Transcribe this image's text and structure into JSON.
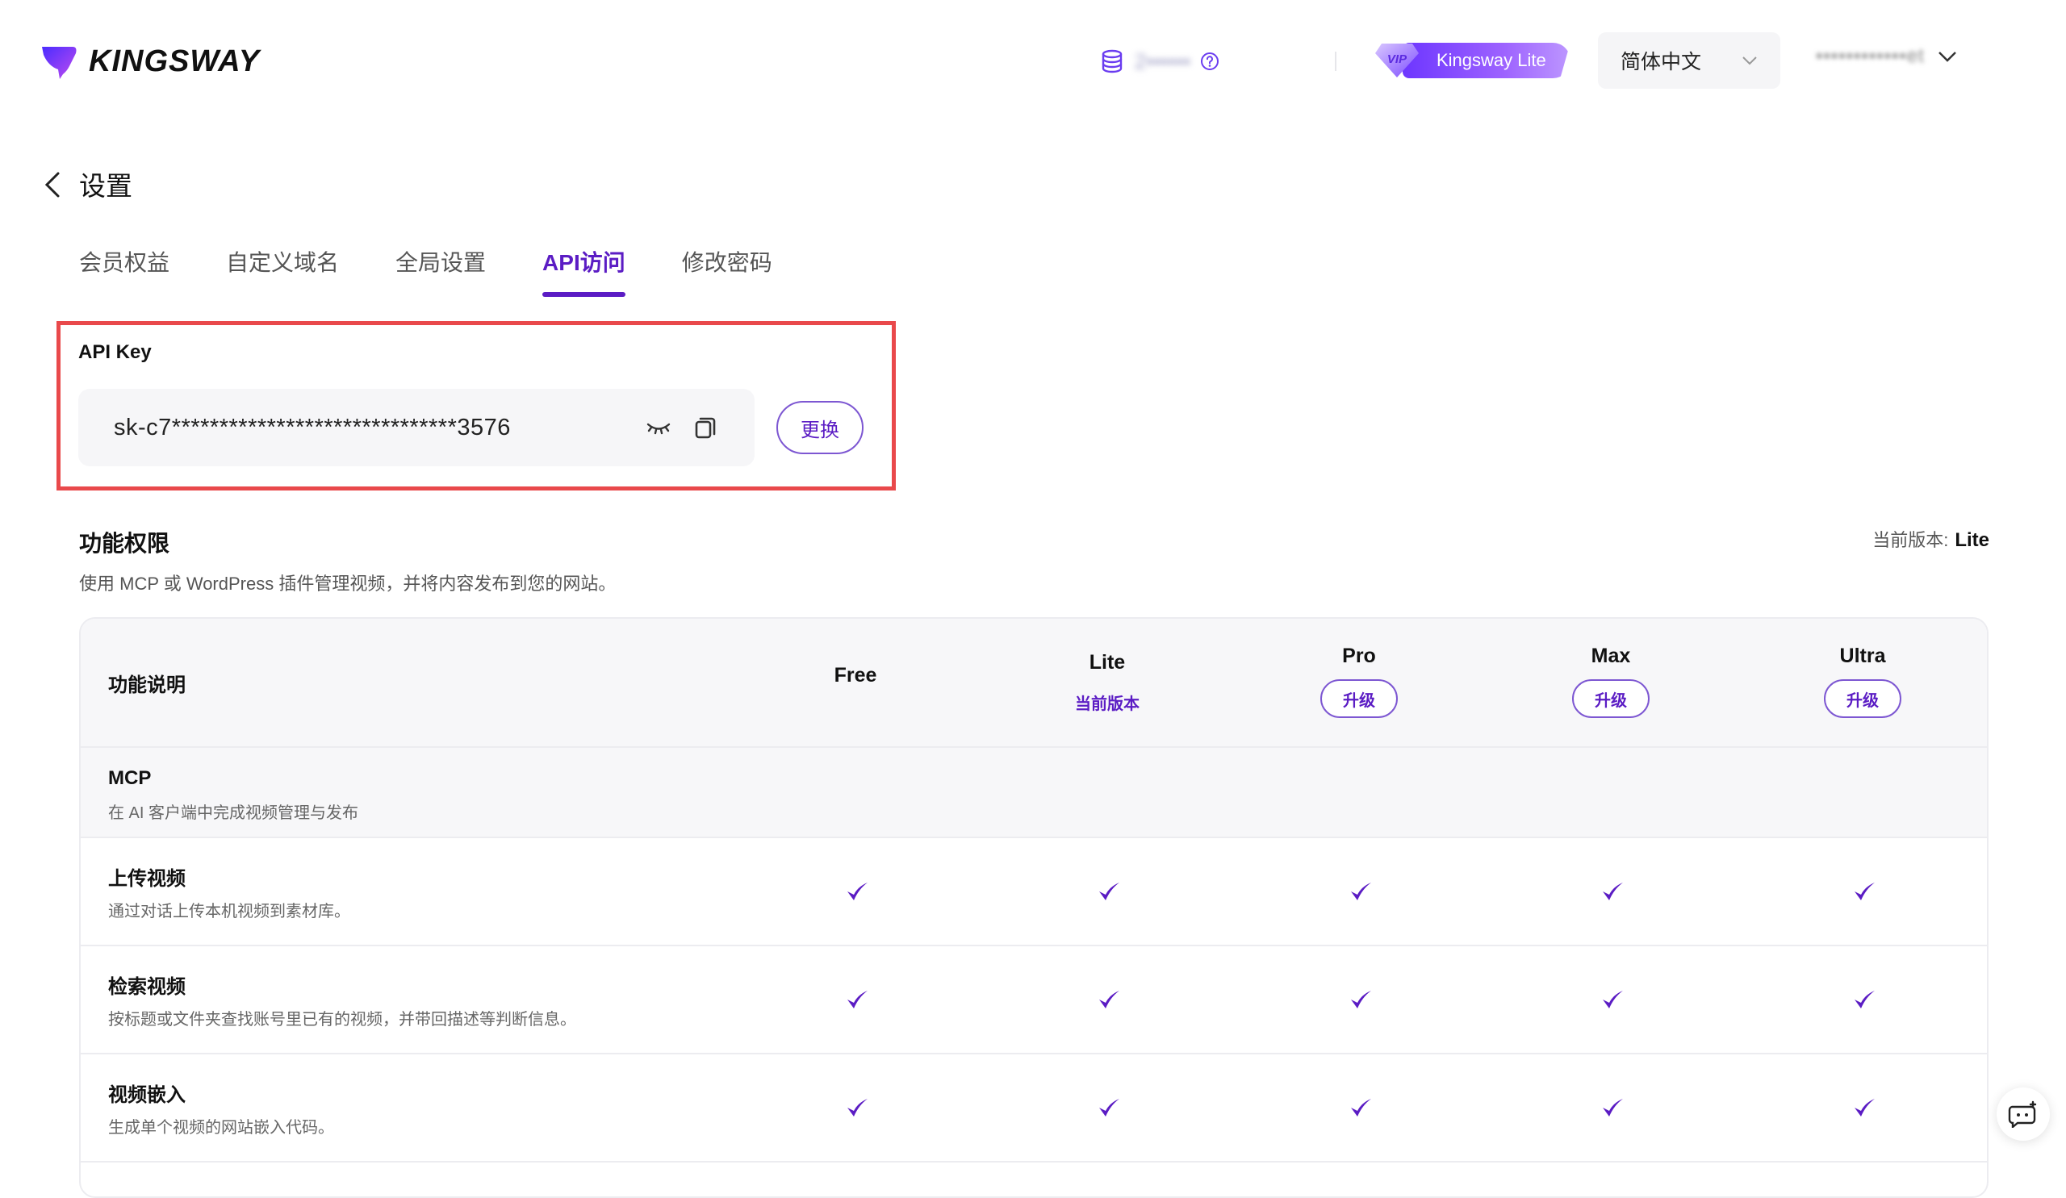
{
  "brand": {
    "name": "KINGSWAY",
    "accent": "#5b1cc4"
  },
  "header": {
    "credits_value": "2••••••",
    "vip_tag": "VIP",
    "vip_label": "Kingsway Lite",
    "language": "简体中文",
    "username": "••••••••••••et"
  },
  "page": {
    "title": "设置"
  },
  "tabs": [
    {
      "label": "会员权益",
      "active": false
    },
    {
      "label": "自定义域名",
      "active": false
    },
    {
      "label": "全局设置",
      "active": false
    },
    {
      "label": "API访问",
      "active": true
    },
    {
      "label": "修改密码",
      "active": false
    }
  ],
  "api": {
    "label": "API Key",
    "key_masked": "sk-c7******************************3576",
    "change_label": "更换"
  },
  "features": {
    "title": "功能权限",
    "description": "使用 MCP 或 WordPress 插件管理视频，并将内容发布到您的网站。",
    "current_version_label": "当前版本:",
    "current_version": "Lite",
    "table": {
      "header_label": "功能说明",
      "plans": [
        {
          "name": "Free",
          "status": ""
        },
        {
          "name": "Lite",
          "status": "当前版本"
        },
        {
          "name": "Pro",
          "status": "升级"
        },
        {
          "name": "Max",
          "status": "升级"
        },
        {
          "name": "Ultra",
          "status": "升级"
        }
      ],
      "group": {
        "title": "MCP",
        "description": "在 AI 客户端中完成视频管理与发布"
      },
      "rows": [
        {
          "title": "上传视频",
          "description": "通过对话上传本机视频到素材库。",
          "available": [
            true,
            true,
            true,
            true,
            true
          ]
        },
        {
          "title": "检索视频",
          "description": "按标题或文件夹查找账号里已有的视频，并带回描述等判断信息。",
          "available": [
            true,
            true,
            true,
            true,
            true
          ]
        },
        {
          "title": "视频嵌入",
          "description": "生成单个视频的网站嵌入代码。",
          "available": [
            true,
            true,
            true,
            true,
            true
          ]
        }
      ]
    }
  }
}
